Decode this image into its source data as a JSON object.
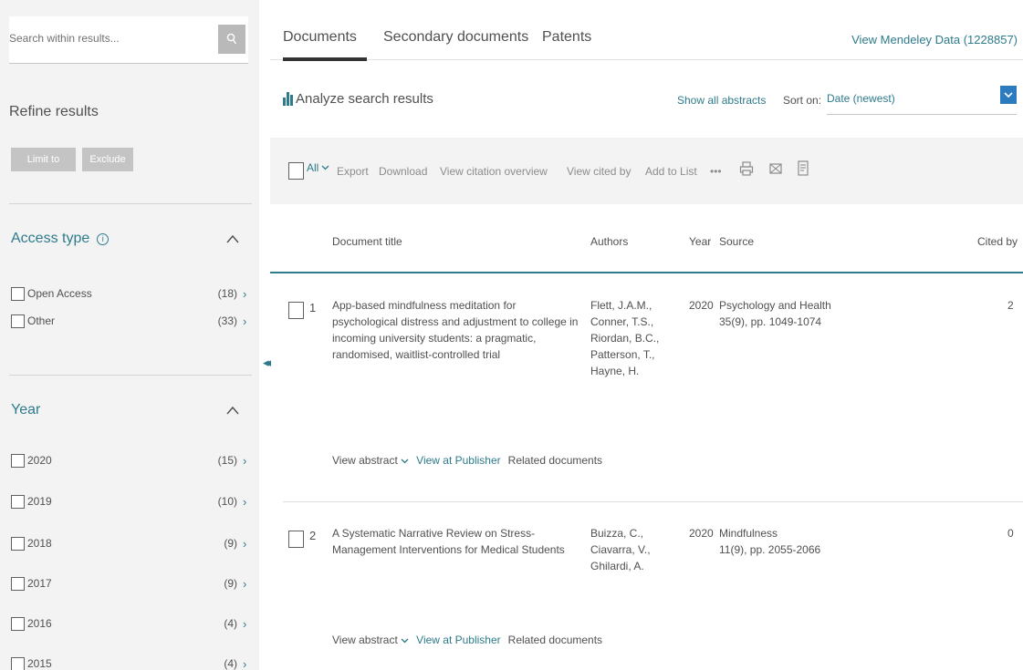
{
  "sidebar": {
    "search_placeholder": "Search within results...",
    "refine_title": "Refine results",
    "limit_label": "Limit to",
    "exclude_label": "Exclude",
    "access_type": {
      "title": "Access type",
      "items": [
        {
          "label": "Open Access",
          "count": "(18)"
        },
        {
          "label": "Other",
          "count": "(33)"
        }
      ]
    },
    "year": {
      "title": "Year",
      "items": [
        {
          "label": "2020",
          "count": "(15)"
        },
        {
          "label": "2019",
          "count": "(10)"
        },
        {
          "label": "2018",
          "count": "(9)"
        },
        {
          "label": "2017",
          "count": "(9)"
        },
        {
          "label": "2016",
          "count": "(4)"
        },
        {
          "label": "2015",
          "count": "(4)"
        }
      ]
    }
  },
  "tabs": [
    "Documents",
    "Secondary documents",
    "Patents"
  ],
  "mendeley_link": "View Mendeley Data (1228857)",
  "analyze_label": "Analyze search results",
  "show_all_abstracts": "Show all abstracts",
  "sort": {
    "label": "Sort on:",
    "value": "Date (newest)"
  },
  "toolbar": {
    "all_label": "All",
    "export": "Export",
    "download": "Download",
    "citation_overview": "View citation overview",
    "cited_by": "View cited by",
    "add_to_list": "Add to List",
    "more": "•••"
  },
  "columns": {
    "title": "Document title",
    "authors": "Authors",
    "year": "Year",
    "source": "Source",
    "cited_by": "Cited by"
  },
  "results": [
    {
      "num": "1",
      "title": "App-based mindfulness meditation for psychological distress and adjustment to college in incoming university students: a pragmatic, randomised, waitlist-controlled trial",
      "authors": "Flett, J.A.M., Conner, T.S., Riordan, B.C., Patterson, T., Hayne, H.",
      "year": "2020",
      "source_name": "Psychology and Health",
      "source_detail": "35(9), pp. 1049-1074",
      "cited": "2",
      "view_abstract": "View abstract",
      "view_publisher": "View at Publisher",
      "related": "Related documents"
    },
    {
      "num": "2",
      "title": "A Systematic Narrative Review on Stress-Management Interventions for Medical Students",
      "authors": "Buizza, C., Ciavarra, V., Ghilardi, A.",
      "year": "2020",
      "source_name": "Mindfulness",
      "source_detail": "11(9), pp. 2055-2066",
      "cited": "0",
      "view_abstract": "View abstract",
      "view_publisher": "View at Publisher",
      "related": "Related documents"
    }
  ]
}
